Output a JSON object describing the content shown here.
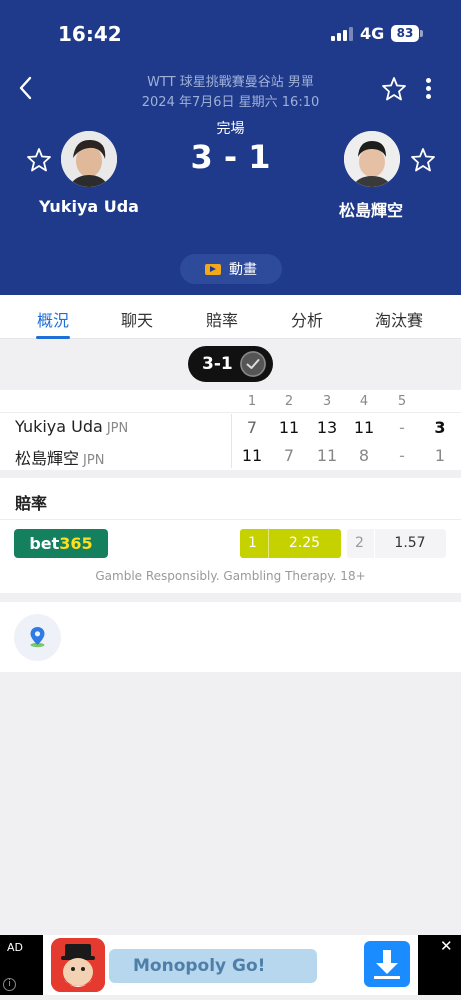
{
  "status_bar": {
    "time": "16:42",
    "network": "4G",
    "battery": "83"
  },
  "header": {
    "competition": "WTT 球星挑戰賽曼谷站 男單",
    "datetime": "2024 年7月6日 星期六 16:10",
    "match_status": "完場",
    "score": "3 - 1",
    "home_name": "Yukiya Uda",
    "away_name": "松島輝空",
    "video_label": "動畫"
  },
  "tabs": [
    "概況",
    "聊天",
    "賠率",
    "分析",
    "淘汰賽"
  ],
  "active_tab": 0,
  "set_summary": "3-1",
  "sets": {
    "headers": [
      "1",
      "2",
      "3",
      "4",
      "5"
    ],
    "rows": [
      {
        "name": "Yukiya Uda",
        "nat": "JPN",
        "scores": [
          "7",
          "11",
          "13",
          "11",
          "-"
        ],
        "total": "3"
      },
      {
        "name": "松島輝空",
        "nat": "JPN",
        "scores": [
          "11",
          "7",
          "11",
          "8",
          "-"
        ],
        "total": "1"
      }
    ]
  },
  "odds": {
    "title": "賠率",
    "bookmaker_a": "bet",
    "bookmaker_b": "365",
    "home_key": "1",
    "home_value": "2.25",
    "away_key": "2",
    "away_value": "1.57",
    "disclaimer": "Gamble Responsibly. Gambling Therapy. 18+"
  },
  "ad": {
    "label": "AD",
    "info": "i",
    "headline": "Monopoly Go!",
    "close": "✕"
  },
  "icons": {
    "back": "chevron-left-icon",
    "star": "star-outline-icon",
    "more": "more-vertical-icon",
    "check": "check-circle-icon",
    "location": "location-pin-icon",
    "download": "download-icon"
  },
  "colors": {
    "header_bg": "#1f3a8a",
    "accent": "#1f6fd6",
    "odd_highlight": "#c6d100",
    "bet365_green": "#14805e",
    "bet365_yellow": "#ffdf1b"
  }
}
